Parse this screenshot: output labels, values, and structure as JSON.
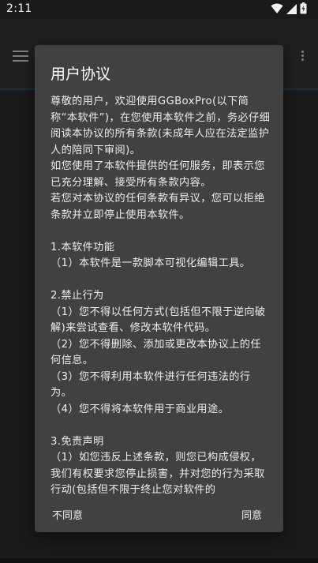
{
  "status_bar": {
    "time": "2:11"
  },
  "dialog": {
    "title": "用户协议",
    "paragraphs": [
      "尊敬的用户，欢迎使用GGBoxPro(以下简称“本软件”)，在您使用本软件之前，务必仔细阅读本协议的所有条款(未成年人应在法定监护人的陪同下审阅)。",
      "如您使用了本软件提供的任何服务，即表示您已充分理解、接受所有条款内容。",
      "若您对本协议的任何条款有异议，您可以拒绝条款并立即停止使用本软件。",
      "",
      "1.本软件功能",
      "（1）本软件是一款脚本可视化编辑工具。",
      "",
      "2.禁止行为",
      "（1）您不得以任何方式(包括但不限于逆向破解)来尝试查看、修改本软件代码。",
      "（2）您不得删除、添加或更改本协议上的任何信息。",
      "（3）您不得利用本软件进行任何违法的行为。",
      "（4）您不得将本软件用于商业用途。",
      "",
      "3.免责声明",
      "（1）如您违反上述条款，则您已构成侵权，我们有权要求您停止损害，并对您的行为采取行动(包括但不限于终止您对软件的"
    ],
    "disagree_label": "不同意",
    "agree_label": "同意"
  },
  "icons": {
    "menu": "menu-icon",
    "overflow": "overflow-menu-icon",
    "wifi": "wifi-icon",
    "signal": "signal-icon",
    "battery": "battery-icon"
  },
  "colors": {
    "dialog_background": "#414141",
    "app_bar": "#262626",
    "status_bar": "#1a1a1a",
    "text": "#ececec"
  }
}
